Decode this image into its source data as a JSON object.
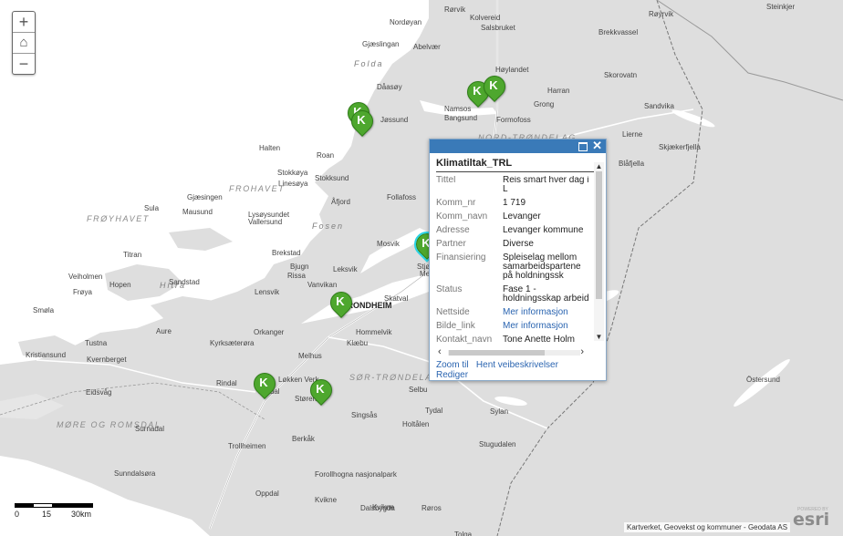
{
  "map": {
    "zoom_in": "+",
    "home": "⌂",
    "zoom_out": "−",
    "water_color": "#ffffff",
    "land_color": "#dedede",
    "marker_color": "#4ea72e",
    "marker_label": "K",
    "labels": [
      {
        "text": "Rørvik"
      },
      {
        "text": "Kolvereid"
      },
      {
        "text": "Salsbruket"
      },
      {
        "text": "Steinkjer"
      },
      {
        "text": "Nordøyan"
      },
      {
        "text": "Gjæslingan"
      },
      {
        "text": "Abelvær"
      },
      {
        "text": "Folda"
      },
      {
        "text": "Dåasøy"
      },
      {
        "text": "Høylandet"
      },
      {
        "text": "Røyrvik"
      },
      {
        "text": "Brekkvassel"
      },
      {
        "text": "Skorovatn"
      },
      {
        "text": "Harran"
      },
      {
        "text": "Namsos"
      },
      {
        "text": "Bangsund"
      },
      {
        "text": "Jøssund"
      },
      {
        "text": "Grong"
      },
      {
        "text": "Formofoss"
      },
      {
        "text": "Sandvika"
      },
      {
        "text": "NORD-TRØNDELAG"
      },
      {
        "text": "Halten"
      },
      {
        "text": "Roan"
      },
      {
        "text": "Stokkøya"
      },
      {
        "text": "Linesøya"
      },
      {
        "text": "Stokksund"
      },
      {
        "text": "FROHAVET"
      },
      {
        "text": "Sula"
      },
      {
        "text": "Mausund"
      },
      {
        "text": "Gjæsingen"
      },
      {
        "text": "Åfjord"
      },
      {
        "text": "Follafoss"
      },
      {
        "text": "FRØYHAVET"
      },
      {
        "text": "Lysøysundet"
      },
      {
        "text": "Vallersund"
      },
      {
        "text": "Fosen"
      },
      {
        "text": "Titran"
      },
      {
        "text": "Brekstad"
      },
      {
        "text": "Bjugn"
      },
      {
        "text": "Rissa"
      },
      {
        "text": "Leksvik"
      },
      {
        "text": "Mosvik"
      },
      {
        "text": "Stjørdal"
      },
      {
        "text": "Frøya"
      },
      {
        "text": "Hitra"
      },
      {
        "text": "Veiholmen"
      },
      {
        "text": "Hopen"
      },
      {
        "text": "Sandstad"
      },
      {
        "text": "Lensvik"
      },
      {
        "text": "Vanvikan"
      },
      {
        "text": "TRONDHEIM"
      },
      {
        "text": "Skatval"
      },
      {
        "text": "Meråker"
      },
      {
        "text": "Smøla"
      },
      {
        "text": "Kyrksæterøra"
      },
      {
        "text": "Orkanger"
      },
      {
        "text": "Melhus"
      },
      {
        "text": "Hommelvik"
      },
      {
        "text": "Klæbu"
      },
      {
        "text": "Kristiansund"
      },
      {
        "text": "Kvernberget"
      },
      {
        "text": "Tustna"
      },
      {
        "text": "Aure"
      },
      {
        "text": "Rindal"
      },
      {
        "text": "Løkken Verk"
      },
      {
        "text": "Støren"
      },
      {
        "text": "SØR-TRØNDELAG"
      },
      {
        "text": "Selbu"
      },
      {
        "text": "Tydal"
      },
      {
        "text": "Meldal"
      },
      {
        "text": "Sunndalsøra"
      },
      {
        "text": "MØRE OG ROMSDAL"
      },
      {
        "text": "Oppdal"
      },
      {
        "text": "Berkåk"
      },
      {
        "text": "Singsås"
      },
      {
        "text": "Holtålen"
      },
      {
        "text": "Røros"
      },
      {
        "text": "Kvikne"
      },
      {
        "text": "Dalsbygda"
      },
      {
        "text": "Tolga"
      },
      {
        "text": "Östersund"
      },
      {
        "text": "Sylan"
      },
      {
        "text": "Stugudalen"
      },
      {
        "text": "Lierne"
      },
      {
        "text": "Blåfjella"
      },
      {
        "text": "Skjækerfjella"
      },
      {
        "text": "Eidsvåg"
      },
      {
        "text": "Surnadal"
      },
      {
        "text": "Trollheimen"
      },
      {
        "text": "Forollhogna nasjonalpark"
      },
      {
        "text": "Kvikne"
      }
    ]
  },
  "popup": {
    "title": "Klimatiltak_TRL",
    "fields": [
      {
        "key": "Tittel",
        "value": "Reis smart hver dag i L"
      },
      {
        "key": "Komm_nr",
        "value": "1 719"
      },
      {
        "key": "Komm_navn",
        "value": "Levanger"
      },
      {
        "key": "Adresse",
        "value": "Levanger kommune"
      },
      {
        "key": "Partner",
        "value": "Diverse"
      },
      {
        "key": "Finansiering",
        "value": "Spleiselag mellom samarbeidspartene på holdningssk"
      },
      {
        "key": "Status",
        "value": "Fase 1 - holdningsskap arbeid"
      },
      {
        "key": "Nettside",
        "value": "Mer informasjon",
        "link": true
      },
      {
        "key": "Bilde_link",
        "value": "Mer informasjon",
        "link": true
      },
      {
        "key": "Kontakt_navn",
        "value": "Tone Anette Holm"
      }
    ],
    "zoom_to": "Zoom til",
    "directions": "Hent veibeskrivelser",
    "edit": "Rediger"
  },
  "scalebar": {
    "labels": [
      "0",
      "15",
      "30km"
    ]
  },
  "attribution": "Kartverket, Geovekst og kommuner - Geodata AS",
  "logo": "esri",
  "logo_sub": "POWERED BY"
}
